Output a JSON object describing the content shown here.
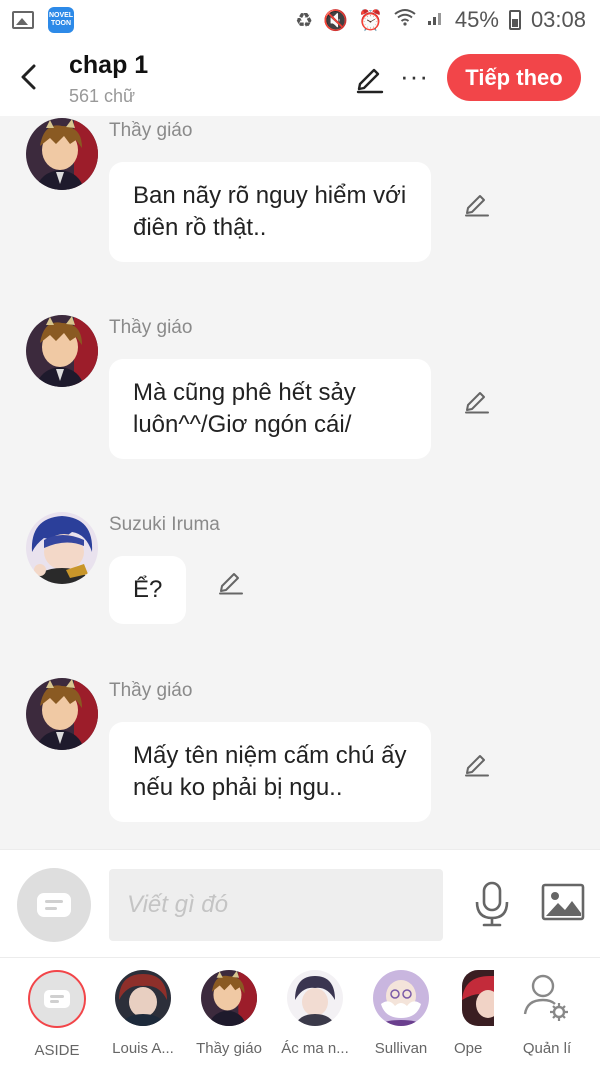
{
  "status_bar": {
    "novel_app_label": "NOVEL TOON",
    "battery": "45%",
    "time": "03:08"
  },
  "header": {
    "title": "chap 1",
    "subtitle": "561 chữ",
    "next_label": "Tiếp theo",
    "more_label": "···"
  },
  "messages": [
    {
      "sender": "Thầy giáo",
      "text": "Ban nãy rõ nguy hiểm với điên rồ thật..",
      "avatar": "teacher-avatar"
    },
    {
      "sender": "Thầy giáo",
      "text": "Mà cũng phê hết sảy luôn^^/Giơ ngón cái/",
      "avatar": "teacher-avatar"
    },
    {
      "sender": "Suzuki Iruma",
      "text": "Ể?",
      "avatar": "iruma-avatar"
    },
    {
      "sender": "Thầy giáo",
      "text": "Mấy tên niệm cấm chú ấy nếu ko phải bị ngu..",
      "avatar": "teacher-avatar"
    }
  ],
  "composer": {
    "placeholder": "Viết gì đó"
  },
  "characters": [
    {
      "name": "ASIDE"
    },
    {
      "name": "Louis A..."
    },
    {
      "name": "Thầy giáo"
    },
    {
      "name": "Ác ma n..."
    },
    {
      "name": "Sullivan"
    },
    {
      "name": "Ope"
    },
    {
      "name": "Quản lí"
    }
  ],
  "colors": {
    "accent": "#f24549",
    "background": "#f4f4f4",
    "bubble": "#ffffff"
  }
}
